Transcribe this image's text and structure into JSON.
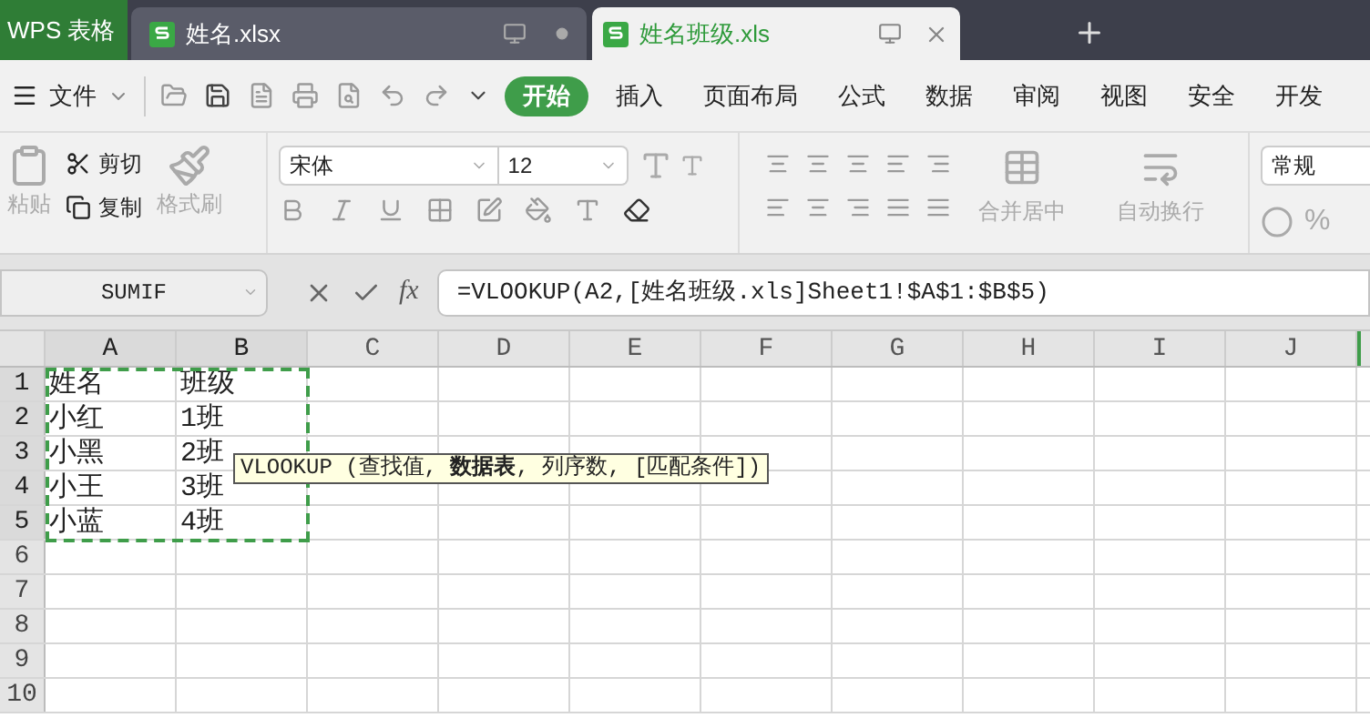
{
  "app_tab": {
    "label": "WPS 表格"
  },
  "doc_tabs": [
    {
      "label": "姓名.xlsx",
      "selected": false
    },
    {
      "label": "姓名班级.xls",
      "selected": true
    }
  ],
  "menu": {
    "file_label": "文件",
    "ribbon_tabs": [
      {
        "label": "开始",
        "selected": true
      },
      {
        "label": "插入",
        "selected": false
      },
      {
        "label": "页面布局",
        "selected": false
      },
      {
        "label": "公式",
        "selected": false
      },
      {
        "label": "数据",
        "selected": false
      },
      {
        "label": "审阅",
        "selected": false
      },
      {
        "label": "视图",
        "selected": false
      },
      {
        "label": "安全",
        "selected": false
      },
      {
        "label": "开发",
        "selected": false
      }
    ]
  },
  "ribbon": {
    "paste": "粘贴",
    "cut": "剪切",
    "copy": "复制",
    "format_painter": "格式刷",
    "font_name": "宋体",
    "font_size": "12",
    "merge": "合并居中",
    "wrap": "自动换行",
    "number_format": "常规",
    "percent": "%"
  },
  "formula_bar": {
    "name_box": "SUMIF",
    "fx": "fx",
    "formula": "=VLOOKUP(A2,[姓名班级.xls]Sheet1!$A$1:$B$5)"
  },
  "grid": {
    "columns": [
      {
        "label": "A",
        "in_range": true
      },
      {
        "label": "B",
        "in_range": true
      },
      {
        "label": "C",
        "in_range": false
      },
      {
        "label": "D",
        "in_range": false
      },
      {
        "label": "E",
        "in_range": false
      },
      {
        "label": "F",
        "in_range": false
      },
      {
        "label": "G",
        "in_range": false
      },
      {
        "label": "H",
        "in_range": false
      },
      {
        "label": "I",
        "in_range": false
      },
      {
        "label": "J",
        "in_range": false
      }
    ],
    "rows": [
      {
        "header": "1",
        "cells": [
          "姓名",
          "班级"
        ],
        "in_range": true
      },
      {
        "header": "2",
        "cells": [
          "小红",
          "1班"
        ],
        "in_range": true
      },
      {
        "header": "3",
        "cells": [
          "小黑",
          "2班"
        ],
        "in_range": true
      },
      {
        "header": "4",
        "cells": [
          "小王",
          "3班"
        ],
        "in_range": true
      },
      {
        "header": "5",
        "cells": [
          "小蓝",
          "4班"
        ],
        "in_range": true
      },
      {
        "header": "6",
        "cells": [],
        "in_range": false
      },
      {
        "header": "7",
        "cells": [],
        "in_range": false
      },
      {
        "header": "8",
        "cells": [],
        "in_range": false
      },
      {
        "header": "9",
        "cells": [],
        "in_range": false
      },
      {
        "header": "10",
        "cells": [],
        "in_range": false
      }
    ]
  },
  "tooltip": {
    "text": "VLOOKUP (查找值, **数据表**, 列序数, [匹配条件])"
  }
}
